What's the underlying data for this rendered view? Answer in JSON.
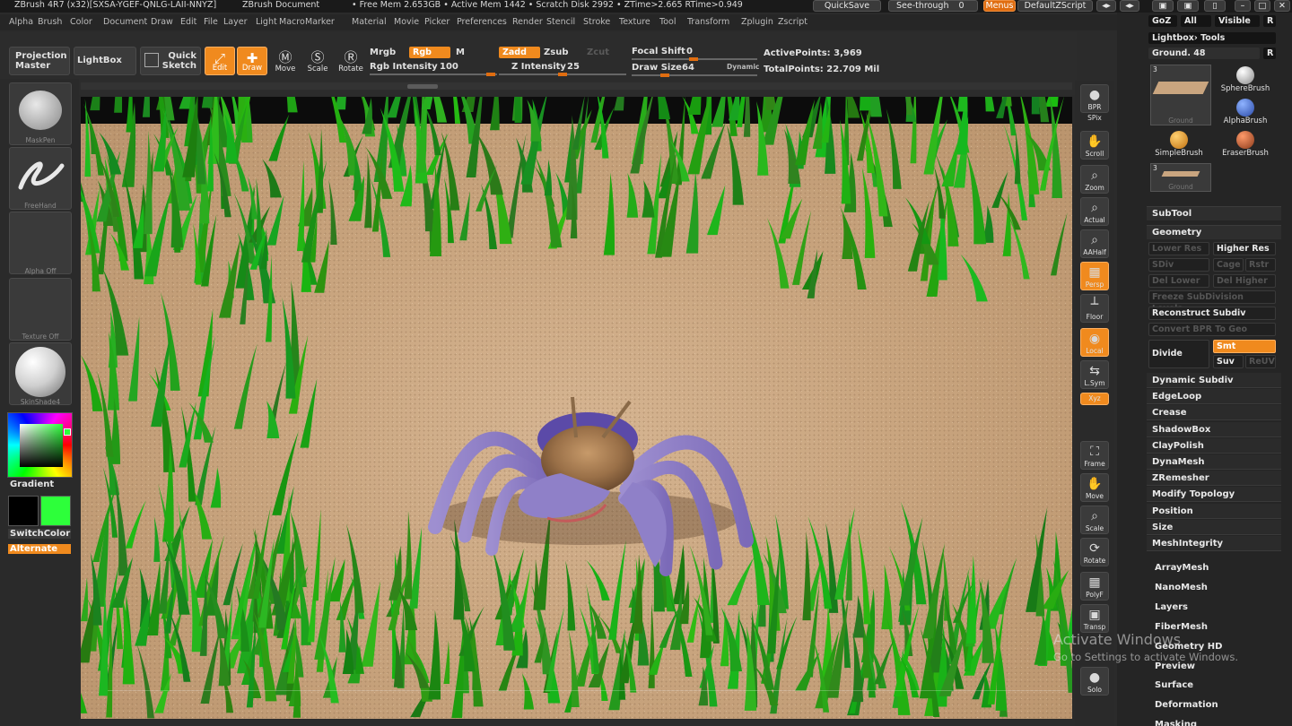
{
  "titlebar": {
    "app_title": "ZBrush 4R7 (x32)[SXSA-YGEF-QNLG-LAII-NNYZ]",
    "document": "ZBrush Document",
    "stats": "• Free Mem 2.653GB • Active Mem 1442 • Scratch Disk 2992 • ZTime>2.665 RTime>0.949",
    "quicksave": "QuickSave",
    "seethrough": "See-through",
    "seethrough_value": "0",
    "menus": "Menus",
    "script": "DefaultZScript"
  },
  "menubar": [
    "Alpha",
    "Brush",
    "Color",
    "Document",
    "Draw",
    "Edit",
    "File",
    "Layer",
    "Light",
    "Macro",
    "Marker",
    "Material",
    "Movie",
    "Picker",
    "Preferences",
    "Render",
    "Stencil",
    "Stroke",
    "Texture",
    "Tool",
    "Transform",
    "Zplugin",
    "Zscript"
  ],
  "toolbar": {
    "projection_master": "Projection Master",
    "lightbox": "LightBox",
    "quick_sketch": "Quick Sketch",
    "edit": "Edit",
    "draw": "Draw",
    "move": "Move",
    "scale": "Scale",
    "rotate": "Rotate",
    "mrgb": "Mrgb",
    "rgb": "Rgb",
    "m": "M",
    "rgb_intensity_label": "Rgb Intensity",
    "rgb_intensity": "100",
    "zadd": "Zadd",
    "zsub": "Zsub",
    "zcut": "Zcut",
    "z_intensity_label": "Z Intensity",
    "z_intensity": "25",
    "focal_shift_label": "Focal Shift",
    "focal_shift": "0",
    "draw_size_label": "Draw Size",
    "draw_size": "64",
    "dynamic": "Dynamic",
    "active_points": "ActivePoints: 3,969",
    "total_points": "TotalPoints: 22.709 Mil"
  },
  "leftshelf": {
    "brush_caption": "MaskPen",
    "stroke_caption": "FreeHand",
    "alpha_caption": "Alpha Off",
    "texture_caption": "Texture Off",
    "material_caption": "SkinShade4",
    "gradient": "Gradient",
    "switchcolor": "SwitchColor",
    "alternate": "Alternate"
  },
  "rightshelf": {
    "bpr": "BPR",
    "spix": "SPix",
    "scroll": "Scroll",
    "zoom": "Zoom",
    "actual": "Actual",
    "aahalf": "AAHalf",
    "persp": "Persp",
    "floor": "Floor",
    "local": "Local",
    "lsym": "L.Sym",
    "xyz": "Xyz",
    "frame": "Frame",
    "move": "Move",
    "scale": "Scale",
    "rotate": "Rotate",
    "polyf": "PolyF",
    "transp": "Transp",
    "solo": "Solo"
  },
  "rightpanel": {
    "goz": "GoZ",
    "all": "All",
    "visible": "Visible",
    "r": "R",
    "lightbox_tools": "Lightbox› Tools",
    "ground_label": "Ground. 48",
    "ground_count": "3",
    "tools": {
      "ground": "Ground",
      "spherebrush": "SphereBrush",
      "alphabrush": "AlphaBrush",
      "simplebrush": "SimpleBrush",
      "eraserbrush": "EraserBrush",
      "ground2": "Ground"
    },
    "subtool": "SubTool",
    "geometry": "Geometry",
    "geo": {
      "lower_res": "Lower Res",
      "higher_res": "Higher Res",
      "sdiv": "SDiv",
      "cage": "Cage",
      "rstr": "Rstr",
      "del_lower": "Del Lower",
      "del_higher": "Del Higher",
      "freeze": "Freeze SubDivision Levels",
      "reconstruct": "Reconstruct Subdiv",
      "convert_bpr": "Convert BPR To Geo",
      "divide": "Divide",
      "smt": "Smt",
      "suv": "Suv",
      "reuv": "ReUV"
    },
    "items": [
      "Dynamic Subdiv",
      "EdgeLoop",
      "Crease",
      "ShadowBox",
      "ClayPolish",
      "DynaMesh",
      "ZRemesher",
      "Modify Topology",
      "Position",
      "Size",
      "MeshIntegrity"
    ],
    "subpalettes": [
      "ArrayMesh",
      "NanoMesh",
      "Layers",
      "FiberMesh",
      "Geometry HD",
      "Preview",
      "Surface",
      "Deformation",
      "Masking"
    ]
  },
  "watermark": {
    "line1": "Activate Windows",
    "line2": "Go to Settings to activate Windows."
  },
  "colors": {
    "accent": "#f08a1e",
    "main_color": "#2dff3a",
    "secondary_color": "#000000",
    "sand": "#c9a57f",
    "grass": "#2f9a1f"
  }
}
